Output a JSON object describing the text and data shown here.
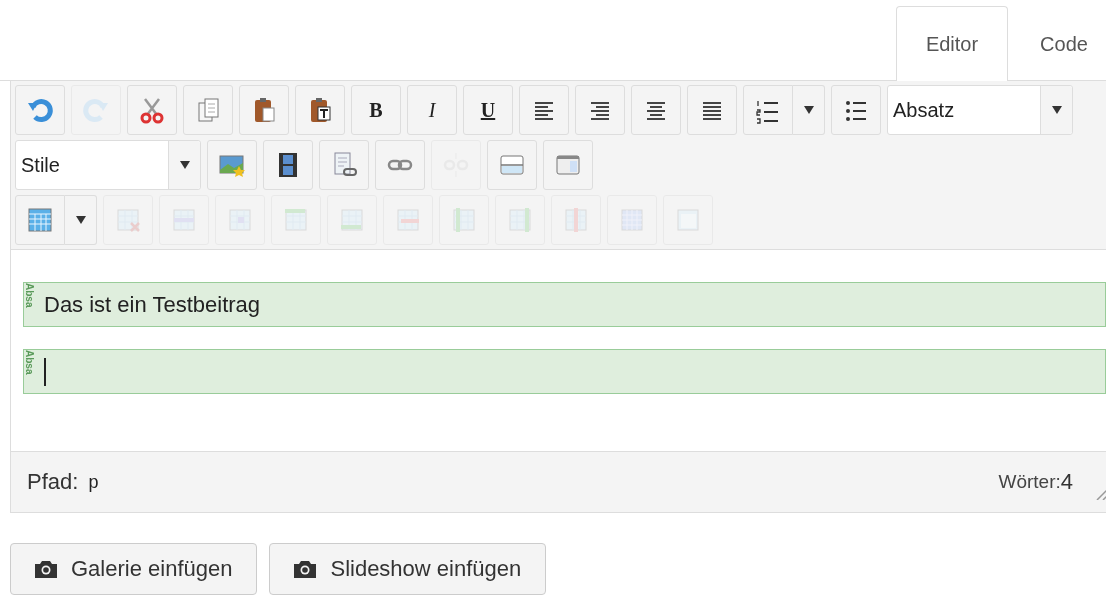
{
  "tabs": [
    {
      "label": "Editor",
      "selected": true
    },
    {
      "label": "Code",
      "selected": false
    }
  ],
  "toolbar": [
    [
      {
        "kind": "button",
        "disabled": false
      },
      {
        "kind": "button",
        "disabled": true
      },
      {
        "kind": "button",
        "disabled": false
      },
      {
        "kind": "button",
        "disabled": false
      },
      {
        "kind": "button",
        "disabled": false
      },
      {
        "kind": "button",
        "disabled": false
      },
      {
        "kind": "text",
        "label": "B",
        "disabled": false
      },
      {
        "kind": "text",
        "label": "I",
        "disabled": false
      },
      {
        "kind": "text",
        "label": "U",
        "disabled": false
      },
      {
        "kind": "button",
        "disabled": false
      },
      {
        "kind": "button",
        "disabled": false
      },
      {
        "kind": "button",
        "disabled": false
      },
      {
        "kind": "button",
        "disabled": false
      },
      {
        "kind": "split",
        "disabled": false
      },
      {
        "kind": "button",
        "disabled": false
      },
      {
        "kind": "select",
        "value": "Absatz"
      }
    ],
    [
      {
        "kind": "select",
        "value": "Stile"
      },
      {
        "kind": "button",
        "disabled": false
      },
      {
        "kind": "button",
        "disabled": false
      },
      {
        "kind": "button",
        "disabled": false
      },
      {
        "kind": "button",
        "disabled": false
      },
      {
        "kind": "button",
        "disabled": true
      },
      {
        "kind": "button",
        "disabled": false
      },
      {
        "kind": "button",
        "disabled": false
      }
    ],
    [
      {
        "kind": "split",
        "disabled": false
      },
      {
        "kind": "button",
        "disabled": true
      },
      {
        "kind": "button",
        "disabled": true
      },
      {
        "kind": "button",
        "disabled": true
      },
      {
        "kind": "button",
        "disabled": true
      },
      {
        "kind": "button",
        "disabled": true
      },
      {
        "kind": "button",
        "disabled": true
      },
      {
        "kind": "button",
        "disabled": true
      },
      {
        "kind": "button",
        "disabled": true
      },
      {
        "kind": "button",
        "disabled": true
      },
      {
        "kind": "button",
        "disabled": true
      },
      {
        "kind": "button",
        "disabled": true
      }
    ]
  ],
  "paragraphs": [
    {
      "tag": "Absa",
      "text": "Das ist ein Testbeitrag",
      "cursor": false
    },
    {
      "tag": "Absa",
      "cursor": true
    }
  ],
  "status_bar": {
    "path_label": "Pfad:",
    "path": "p",
    "words_label": "Wörter:",
    "words": "4"
  },
  "buttons": [
    {
      "label": "Galerie einfügen"
    },
    {
      "label": "Slideshow einfügen"
    }
  ]
}
